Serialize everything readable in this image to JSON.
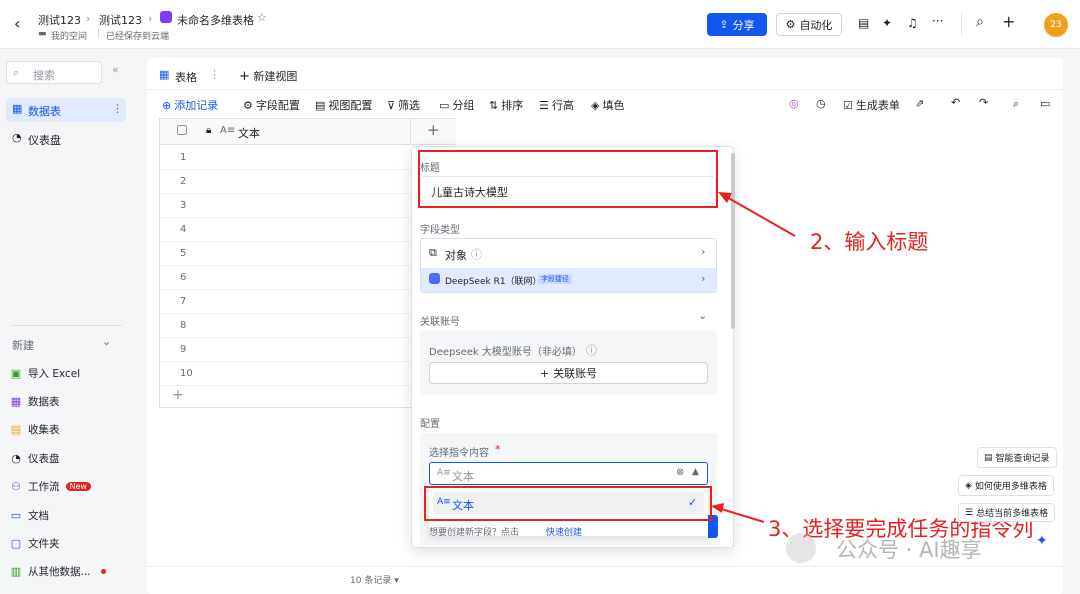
{
  "header": {
    "back_icon": "chevron-left-icon",
    "crumbs": [
      "测试123",
      "测试123"
    ],
    "doc_title": "未命名多维表格",
    "location": "我的空间",
    "save_status": "已经保存到云端",
    "share_label": "分享",
    "automation_label": "自动化",
    "avatar": "23"
  },
  "sidebar": {
    "search_placeholder": "搜索",
    "items": [
      {
        "label": "数据表",
        "active": true
      },
      {
        "label": "仪表盘"
      }
    ],
    "new_section": "新建",
    "new_items": [
      {
        "label": "导入 Excel",
        "icon": "excel-icon",
        "color": "#2ea121"
      },
      {
        "label": "数据表",
        "icon": "table-icon",
        "color": "#7f3bf5"
      },
      {
        "label": "收集表",
        "icon": "form-icon",
        "color": "#f5a623"
      },
      {
        "label": "仪表盘",
        "icon": "dashboard-icon",
        "color": "#1f2329"
      },
      {
        "label": "工作流",
        "icon": "workflow-icon",
        "color": "#7f3bf5",
        "badge": "New"
      },
      {
        "label": "文档",
        "icon": "doc-icon",
        "color": "#1456f0"
      },
      {
        "label": "文件夹",
        "icon": "folder-icon",
        "color": "#1456f0"
      },
      {
        "label": "从其他数据...",
        "icon": "import-icon",
        "color": "#2ea121"
      }
    ]
  },
  "tabs": {
    "active": "表格",
    "new_view": "新建视图"
  },
  "toolbar": {
    "add_record": "添加记录",
    "field_config": "字段配置",
    "view_config": "视图配置",
    "filter": "筛选",
    "group": "分组",
    "sort": "排序",
    "row_height": "行高",
    "fill_color": "填色",
    "gen_form": "生成表单"
  },
  "grid": {
    "column": "文本",
    "rows": [
      "1",
      "2",
      "3",
      "4",
      "5",
      "6",
      "7",
      "8",
      "9",
      "10"
    ],
    "footer": "10 条记录"
  },
  "panel": {
    "title_label": "标题",
    "title_value": "儿童古诗大模型",
    "field_type_label": "字段类型",
    "type_object": "对象",
    "type_model": "DeepSeek R1（联网）",
    "type_model_tag": "字段捷径",
    "linked_account_label": "关联账号",
    "account_hint": "Deepseek 大模型账号（非必填）",
    "link_account_btn": "关联账号",
    "config_label": "配置",
    "instruction_label": "选择指令内容",
    "required_mark": "*",
    "select_placeholder": "文本",
    "option": "文本",
    "create_hint": "想要创建新字段？点击",
    "create_link": "快速创建"
  },
  "float_buttons": {
    "smart_query": "智能查询记录",
    "how_to_use": "如何使用多维表格",
    "summary": "总结当前多维表格"
  },
  "annotations": {
    "step2": "2、输入标题",
    "step3": "3、选择要完成任务的指令列"
  },
  "watermark": "公众号 · AI趣享",
  "colors": {
    "accent": "#1456f0",
    "annotation": "#e6211e"
  }
}
